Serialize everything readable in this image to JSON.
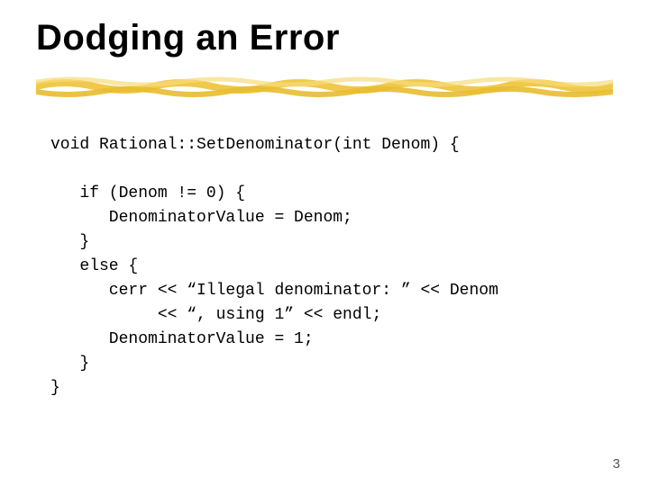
{
  "title": "Dodging an Error",
  "code": "void Rational::SetDenominator(int Denom) {\n\n   if (Denom != 0) {\n      DenominatorValue = Denom;\n   }\n   else {\n      cerr << “Illegal denominator: ” << Denom\n           << “, using 1” << endl;\n      DenominatorValue = 1;\n   }\n}",
  "page_number": "3"
}
